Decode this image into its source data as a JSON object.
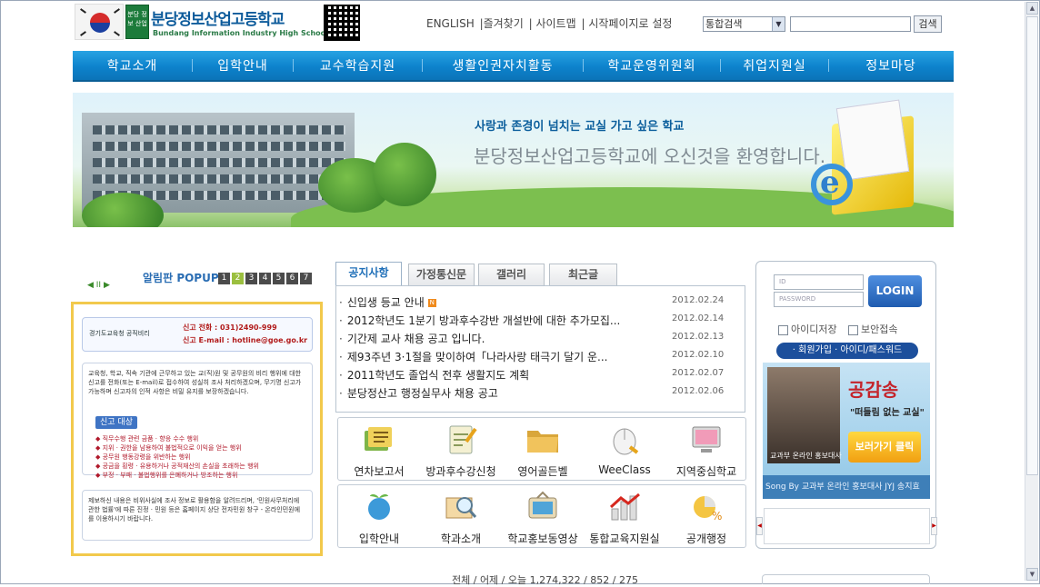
{
  "header": {
    "school_name": "분당정보산업고등학교",
    "school_name_en": "Bundang Information Industry High School",
    "emblem_text": "분당 정보 산업",
    "top_links": [
      "ENGLISH",
      "|즐겨찾기",
      "| 사이트맵",
      "| 시작페이지로 설정"
    ],
    "search": {
      "selected": "통합검색",
      "input_value": "",
      "button": "검색"
    }
  },
  "nav": {
    "items": [
      "학교소개",
      "입학안내",
      "교수학습지원",
      "생활인권자치활동",
      "학교운영위원회",
      "취업지원실",
      "정보마당"
    ]
  },
  "banner": {
    "line1": "사랑과 존경이 넘치는 교실 가고 싶은 학교",
    "line2": "분당정보산업고등학교에 오신것을 환영합니다."
  },
  "popup": {
    "title": "알림판",
    "title_en": "POPUP",
    "pages": [
      "1",
      "2",
      "3",
      "4",
      "5",
      "6",
      "7"
    ],
    "active_page": "2",
    "controls": "◀ II ▶",
    "hotline_org": "경기도교육청 공직비리",
    "hotline_phone": "신고 전화 : 031)2490-999",
    "hotline_email": "신고 E-mail : hotline@goe.go.kr",
    "body": "교육청, 학교, 직속 기관에 근무하고 있는 교(직)원 및 공무원의 비리 행위에 대한 신고를 전화(또는 E-mail)로 접수하여 성실히 조사 처리하겠으며, 무기명 신고가 가능하며 신고자의 인적 사항은 비밀 유지를 보장하겠습니다.",
    "report_button": "신고 대상",
    "items": [
      "◆ 직무수행 관련 금품 · 향응 수수 행위",
      "◆ 지위 · 권한을 남용하여 불법적으로 이익을 얻는 행위",
      "◆ 공무원 행동강령을 위반하는 행위",
      "◆ 공금을 횡령 · 유용하거나 공적재산의 손실을 초래하는 행위",
      "◆ 부정 · 부패 · 불법행위를 은폐하거나 방조하는 행위"
    ],
    "footer": "제보하신 내용은 비위사실에 조사 정보로 활용함을 알려드리며, '민원사무처리에 관한 법률'에 따른 진정 · 민원 등은 홈페이지 상단 전자민원 창구 - 온라인민원에 를 이용하시기 바랍니다."
  },
  "tabs": [
    {
      "label": "공지사항",
      "active": true
    },
    {
      "label": "가정통신문",
      "active": false
    },
    {
      "label": "갤러리",
      "active": false
    },
    {
      "label": "최근글",
      "active": false
    }
  ],
  "notices": [
    {
      "title": "신입생 등교 안내",
      "date": "2012.02.24",
      "new": true,
      "new_label": "N"
    },
    {
      "title": "2012학년도 1분기 방과후수강반 개설반에 대한 추가모집...",
      "date": "2012.02.14",
      "new": false
    },
    {
      "title": "기간제 교사 채용 공고 입니다.",
      "date": "2012.02.13",
      "new": false
    },
    {
      "title": "제93주년 3·1절을 맞이하여「나라사랑 태극기 달기 운...",
      "date": "2012.02.10",
      "new": false
    },
    {
      "title": "2011학년도 졸업식 전후 생활지도 계획",
      "date": "2012.02.07",
      "new": false
    },
    {
      "title": "분당정산고 행정실무사 채용 공고",
      "date": "2012.02.06",
      "new": false
    }
  ],
  "quick_links_row1": [
    {
      "label": "연차보고서",
      "icon": "report-icon"
    },
    {
      "label": "방과후수강신청",
      "icon": "application-icon"
    },
    {
      "label": "영어골든벨",
      "icon": "folder-icon"
    },
    {
      "label": "WeeClass",
      "icon": "mouse-icon"
    },
    {
      "label": "지역중심학교",
      "icon": "monitor-icon"
    }
  ],
  "quick_links_row2": [
    {
      "label": "입학안내",
      "icon": "globe-plant-icon"
    },
    {
      "label": "학과소개",
      "icon": "magnifier-book-icon"
    },
    {
      "label": "학교홍보동영상",
      "icon": "tv-icon"
    },
    {
      "label": "통합교육지원실",
      "icon": "bar-chart-icon"
    },
    {
      "label": "공개행정",
      "icon": "pie-chart-icon"
    }
  ],
  "login": {
    "id_placeholder": "ID",
    "pw_placeholder": "PASSWORD",
    "button": "LOGIN",
    "save_id": "아이디저장",
    "secure": "보안접속",
    "links": "· 회원가입 · 아이디/패스워드"
  },
  "promo": {
    "title": "공감송",
    "subtitle": "\"떠들림 없는 교실\"",
    "button": "보러가기 클릭",
    "caption": "교과부 온라인 홍보대사",
    "song": "Song By 교과부 온라인 홍보대사 JYJ 송지효"
  },
  "visitors": "전체 / 어제 / 오늘 1,274,322 / 852 / 275",
  "colors": {
    "nav": "#0d82cc",
    "accent": "#1f6fb8",
    "popup_border": "#f2c94c"
  }
}
